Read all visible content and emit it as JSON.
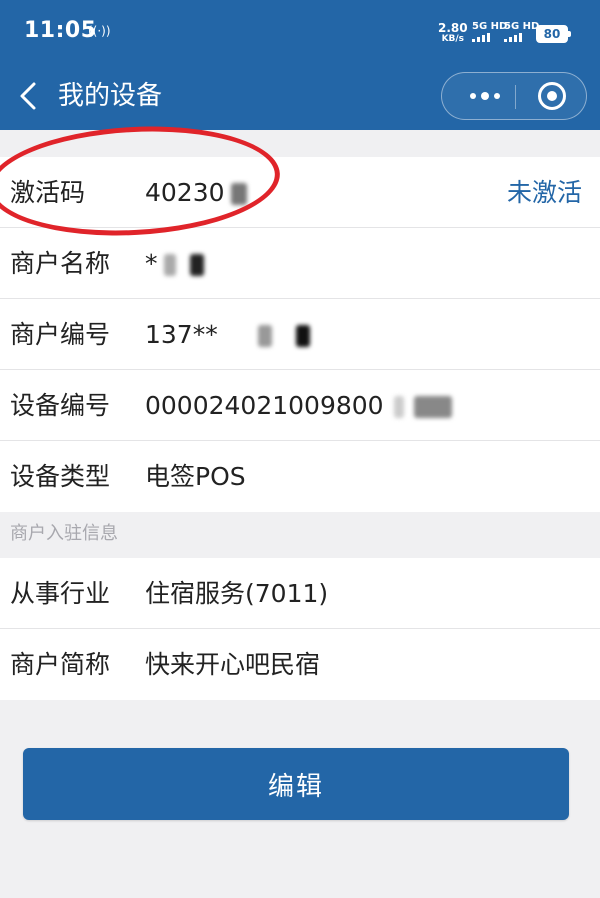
{
  "status_bar": {
    "time": "11:05",
    "net_speed_value": "2.80",
    "net_speed_unit": "KB/s",
    "sim1_label": "5G HD",
    "sim2_label": "5G HD",
    "battery": "80"
  },
  "nav": {
    "title": "我的设备"
  },
  "device_info": [
    {
      "label": "激活码",
      "value": "40230",
      "status": "未激活"
    },
    {
      "label": "商户名称",
      "value": "*"
    },
    {
      "label": "商户编号",
      "value": "137**"
    },
    {
      "label": "设备编号",
      "value": "000024021009800"
    },
    {
      "label": "设备类型",
      "value": "电签POS"
    }
  ],
  "merchant_section": {
    "title": "商户入驻信息",
    "rows": [
      {
        "label": "从事行业",
        "value": "住宿服务(7011)"
      },
      {
        "label": "商户简称",
        "value": "快来开心吧民宿"
      }
    ]
  },
  "edit_button": {
    "label": "编辑"
  },
  "colors": {
    "brand": "#2366a7",
    "background": "#f0f0f2",
    "annotation": "#e0242a"
  },
  "icons": {
    "back": "chevron-left-icon",
    "more": "more-dots-icon",
    "close": "target-circle-icon"
  }
}
